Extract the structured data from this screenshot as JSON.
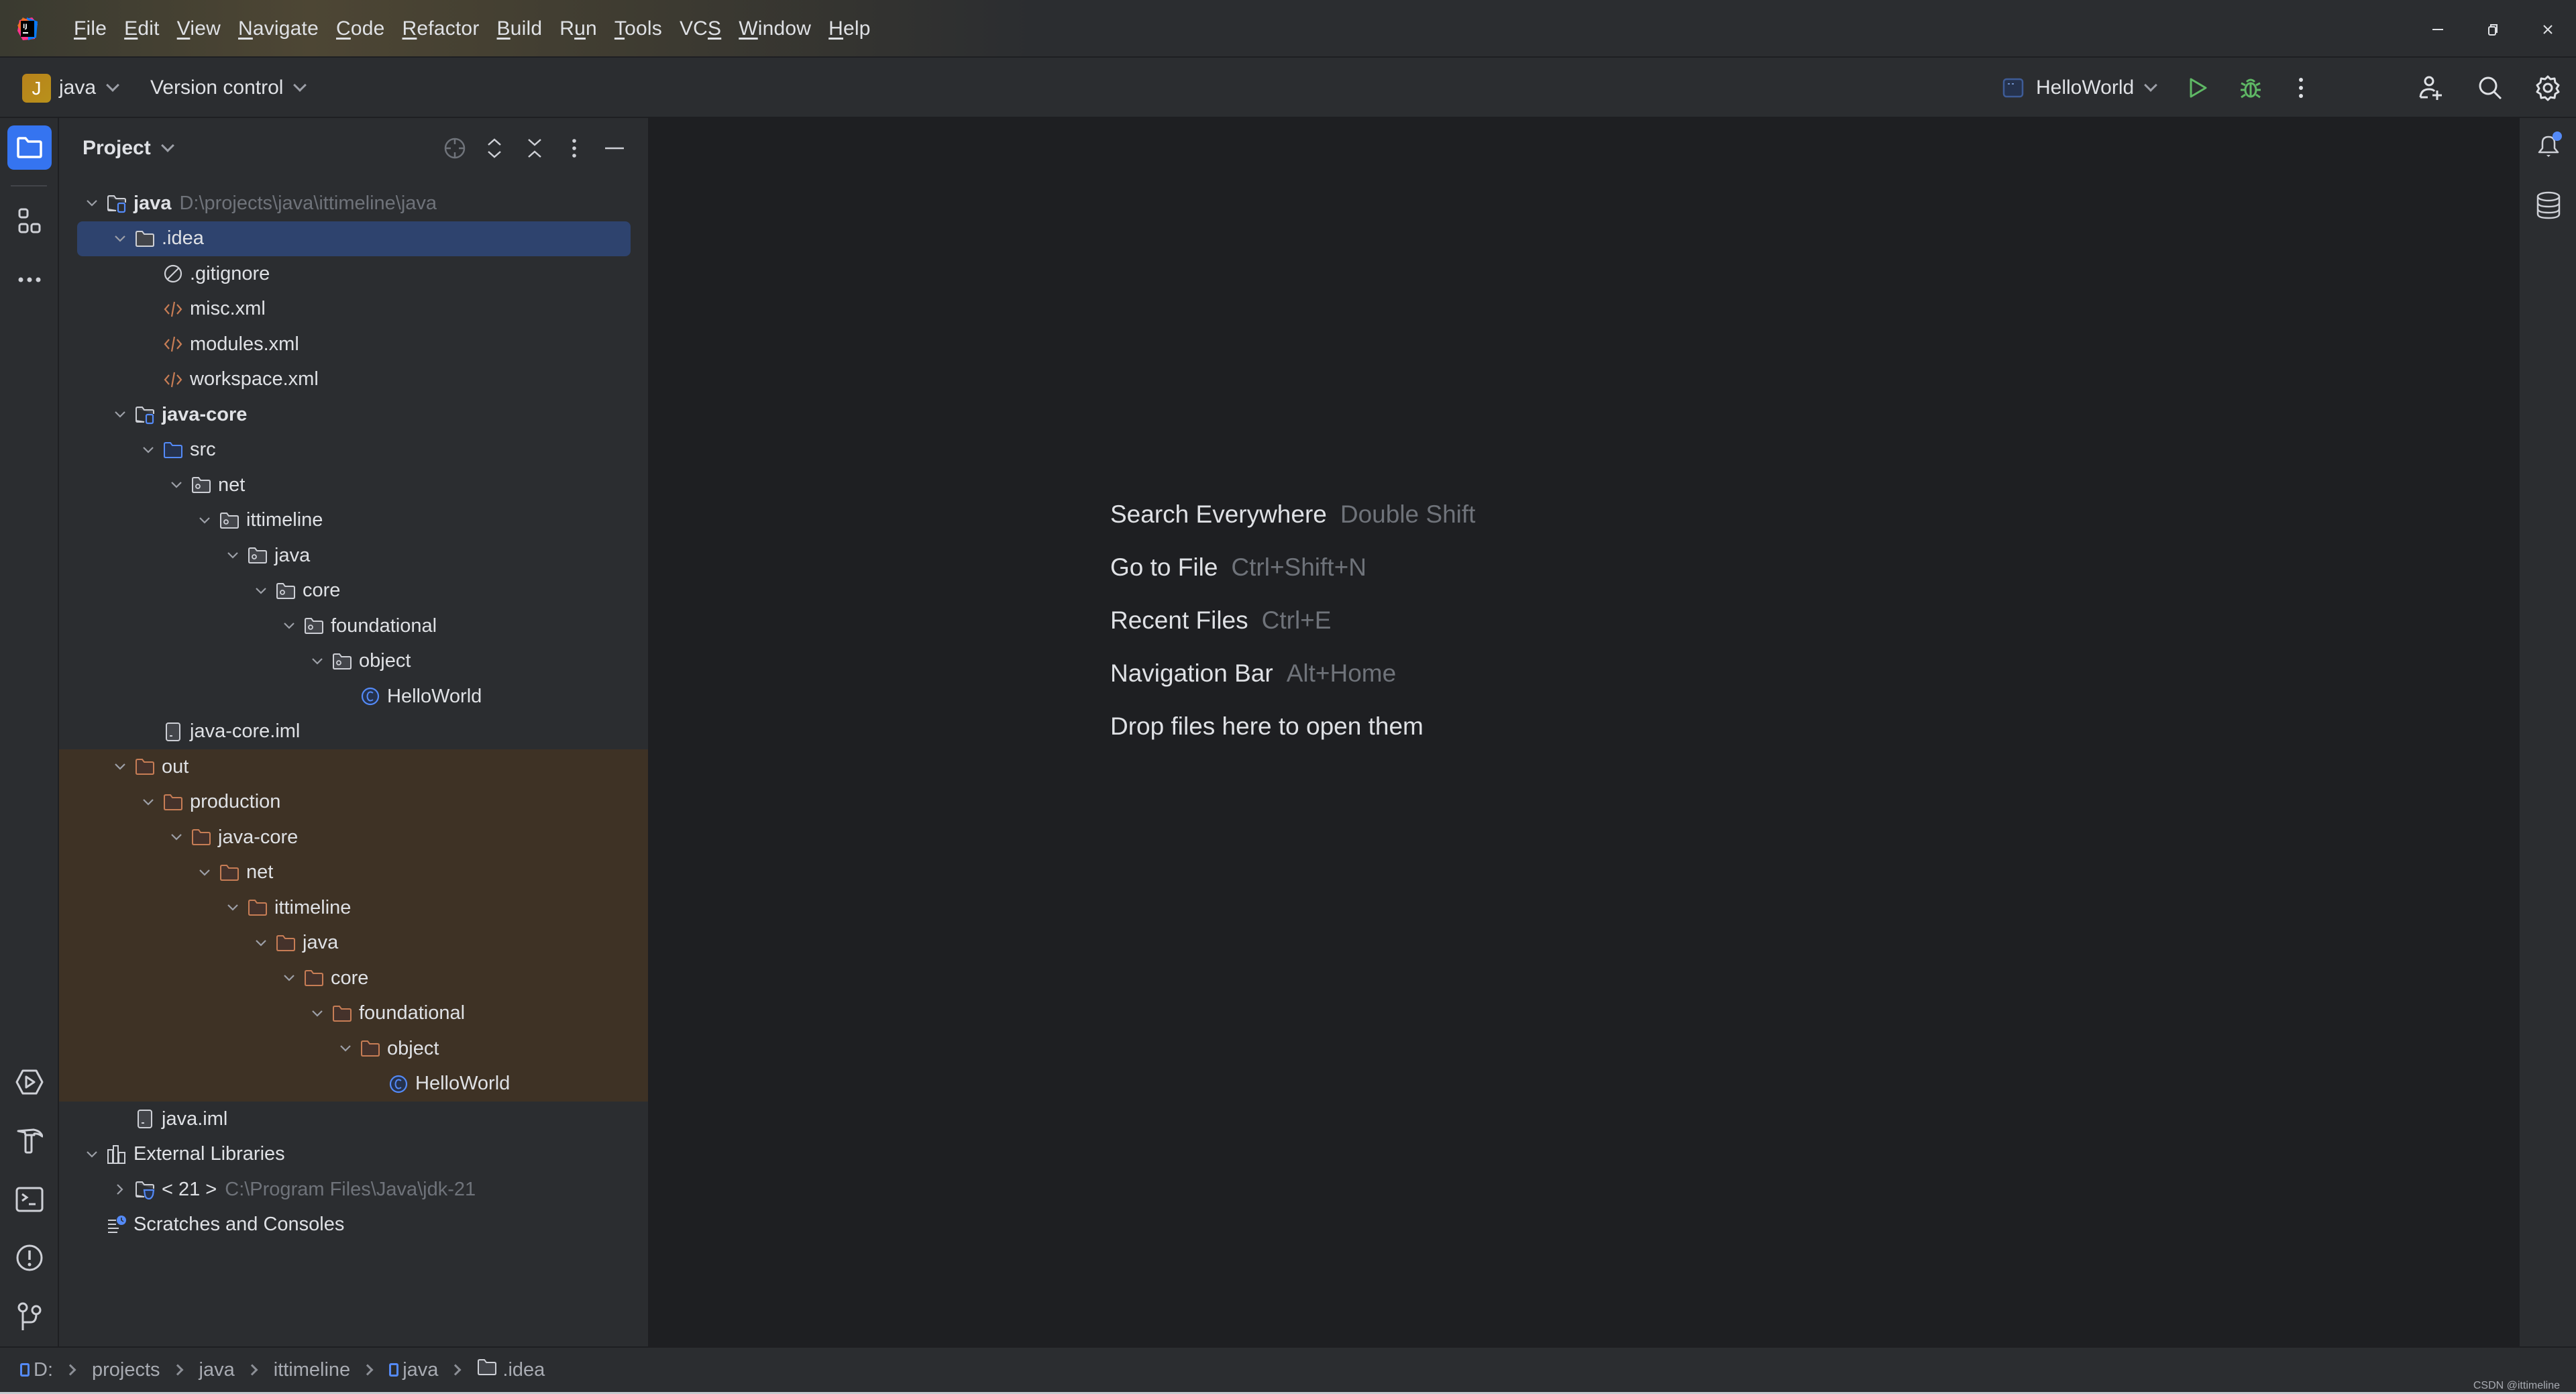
{
  "window": {
    "menu": [
      {
        "label": "File",
        "mnemonic": "F",
        "rest": "ile"
      },
      {
        "label": "Edit",
        "mnemonic": "E",
        "rest": "dit"
      },
      {
        "label": "View",
        "mnemonic": "V",
        "rest": "iew"
      },
      {
        "label": "Navigate",
        "mnemonic": "N",
        "rest": "avigate"
      },
      {
        "label": "Code",
        "mnemonic": "C",
        "rest": "ode"
      },
      {
        "label": "Refactor",
        "mnemonic": "R",
        "rest": "efactor"
      },
      {
        "label": "Build",
        "mnemonic": "B",
        "rest": "uild"
      },
      {
        "label": "Run",
        "pre": "R",
        "mnemonic": "u",
        "rest": "n"
      },
      {
        "label": "Tools",
        "mnemonic": "T",
        "rest": "ools"
      },
      {
        "label": "VCS",
        "pre": "VC",
        "mnemonic": "S",
        "rest": ""
      },
      {
        "label": "Window",
        "mnemonic": "W",
        "rest": "indow"
      },
      {
        "label": "Help",
        "mnemonic": "H",
        "rest": "elp"
      }
    ],
    "controls": {
      "minimize": "minimize-icon",
      "restore": "restore-icon",
      "close": "close-icon"
    }
  },
  "toolbar": {
    "project_badge": "J",
    "project_name": "java",
    "vcs_label": "Version control",
    "run_config": "HelloWorld",
    "badge_color": "#b8861b",
    "run_color": "#5fb865"
  },
  "project_panel": {
    "title": "Project",
    "tree": [
      {
        "label": "java",
        "hint": "D:\\projects\\java\\ittimeline\\java",
        "depth": 0,
        "expanded": true,
        "icon": "module-folder",
        "bold": true
      },
      {
        "label": ".idea",
        "depth": 1,
        "expanded": true,
        "icon": "folder",
        "selected": true
      },
      {
        "label": ".gitignore",
        "depth": 2,
        "icon": "ignore-file"
      },
      {
        "label": "misc.xml",
        "depth": 2,
        "icon": "xml-file"
      },
      {
        "label": "modules.xml",
        "depth": 2,
        "icon": "xml-file"
      },
      {
        "label": "workspace.xml",
        "depth": 2,
        "icon": "xml-file"
      },
      {
        "label": "java-core",
        "depth": 1,
        "expanded": true,
        "icon": "module-folder",
        "bold": true
      },
      {
        "label": "src",
        "depth": 2,
        "expanded": true,
        "icon": "source-folder"
      },
      {
        "label": "net",
        "depth": 3,
        "expanded": true,
        "icon": "package"
      },
      {
        "label": "ittimeline",
        "depth": 4,
        "expanded": true,
        "icon": "package"
      },
      {
        "label": "java",
        "depth": 5,
        "expanded": true,
        "icon": "package"
      },
      {
        "label": "core",
        "depth": 6,
        "expanded": true,
        "icon": "package"
      },
      {
        "label": "foundational",
        "depth": 7,
        "expanded": true,
        "icon": "package"
      },
      {
        "label": "object",
        "depth": 8,
        "expanded": true,
        "icon": "package"
      },
      {
        "label": "HelloWorld",
        "depth": 9,
        "icon": "class"
      },
      {
        "label": "java-core.iml",
        "depth": 2,
        "icon": "iml-file"
      },
      {
        "label": "out",
        "depth": 1,
        "expanded": true,
        "icon": "excluded-folder",
        "excluded": true
      },
      {
        "label": "production",
        "depth": 2,
        "expanded": true,
        "icon": "excluded-folder",
        "excluded": true
      },
      {
        "label": "java-core",
        "depth": 3,
        "expanded": true,
        "icon": "excluded-folder",
        "excluded": true
      },
      {
        "label": "net",
        "depth": 4,
        "expanded": true,
        "icon": "excluded-folder",
        "excluded": true
      },
      {
        "label": "ittimeline",
        "depth": 5,
        "expanded": true,
        "icon": "excluded-folder",
        "excluded": true
      },
      {
        "label": "java",
        "depth": 6,
        "expanded": true,
        "icon": "excluded-folder",
        "excluded": true
      },
      {
        "label": "core",
        "depth": 7,
        "expanded": true,
        "icon": "excluded-folder",
        "excluded": true
      },
      {
        "label": "foundational",
        "depth": 8,
        "expanded": true,
        "icon": "excluded-folder",
        "excluded": true
      },
      {
        "label": "object",
        "depth": 9,
        "expanded": true,
        "icon": "excluded-folder",
        "excluded": true
      },
      {
        "label": "HelloWorld",
        "depth": 10,
        "icon": "class",
        "excluded": true
      },
      {
        "label": "java.iml",
        "depth": 1,
        "icon": "iml-file"
      },
      {
        "label": "External Libraries",
        "depth": 0,
        "expanded": true,
        "icon": "libraries"
      },
      {
        "label": "< 21 >",
        "hint": "C:\\Program Files\\Java\\jdk-21",
        "depth": 1,
        "expanded": false,
        "icon": "jdk-folder"
      },
      {
        "label": "Scratches and Consoles",
        "depth": 0,
        "icon": "scratches"
      }
    ]
  },
  "editor": {
    "hints": [
      {
        "action": "Search Everywhere",
        "shortcut": "Double Shift"
      },
      {
        "action": "Go to File",
        "shortcut": "Ctrl+Shift+N"
      },
      {
        "action": "Recent Files",
        "shortcut": "Ctrl+E"
      },
      {
        "action": "Navigation Bar",
        "shortcut": "Alt+Home"
      },
      {
        "action": "Drop files here to open them",
        "shortcut": ""
      }
    ]
  },
  "statusbar": {
    "breadcrumbs": [
      {
        "label": "D:",
        "icon": "module"
      },
      {
        "label": "projects"
      },
      {
        "label": "java"
      },
      {
        "label": "ittimeline"
      },
      {
        "label": "java",
        "icon": "module"
      },
      {
        "label": ".idea",
        "icon": "folder"
      }
    ],
    "watermark": "CSDN @ittimeline"
  }
}
